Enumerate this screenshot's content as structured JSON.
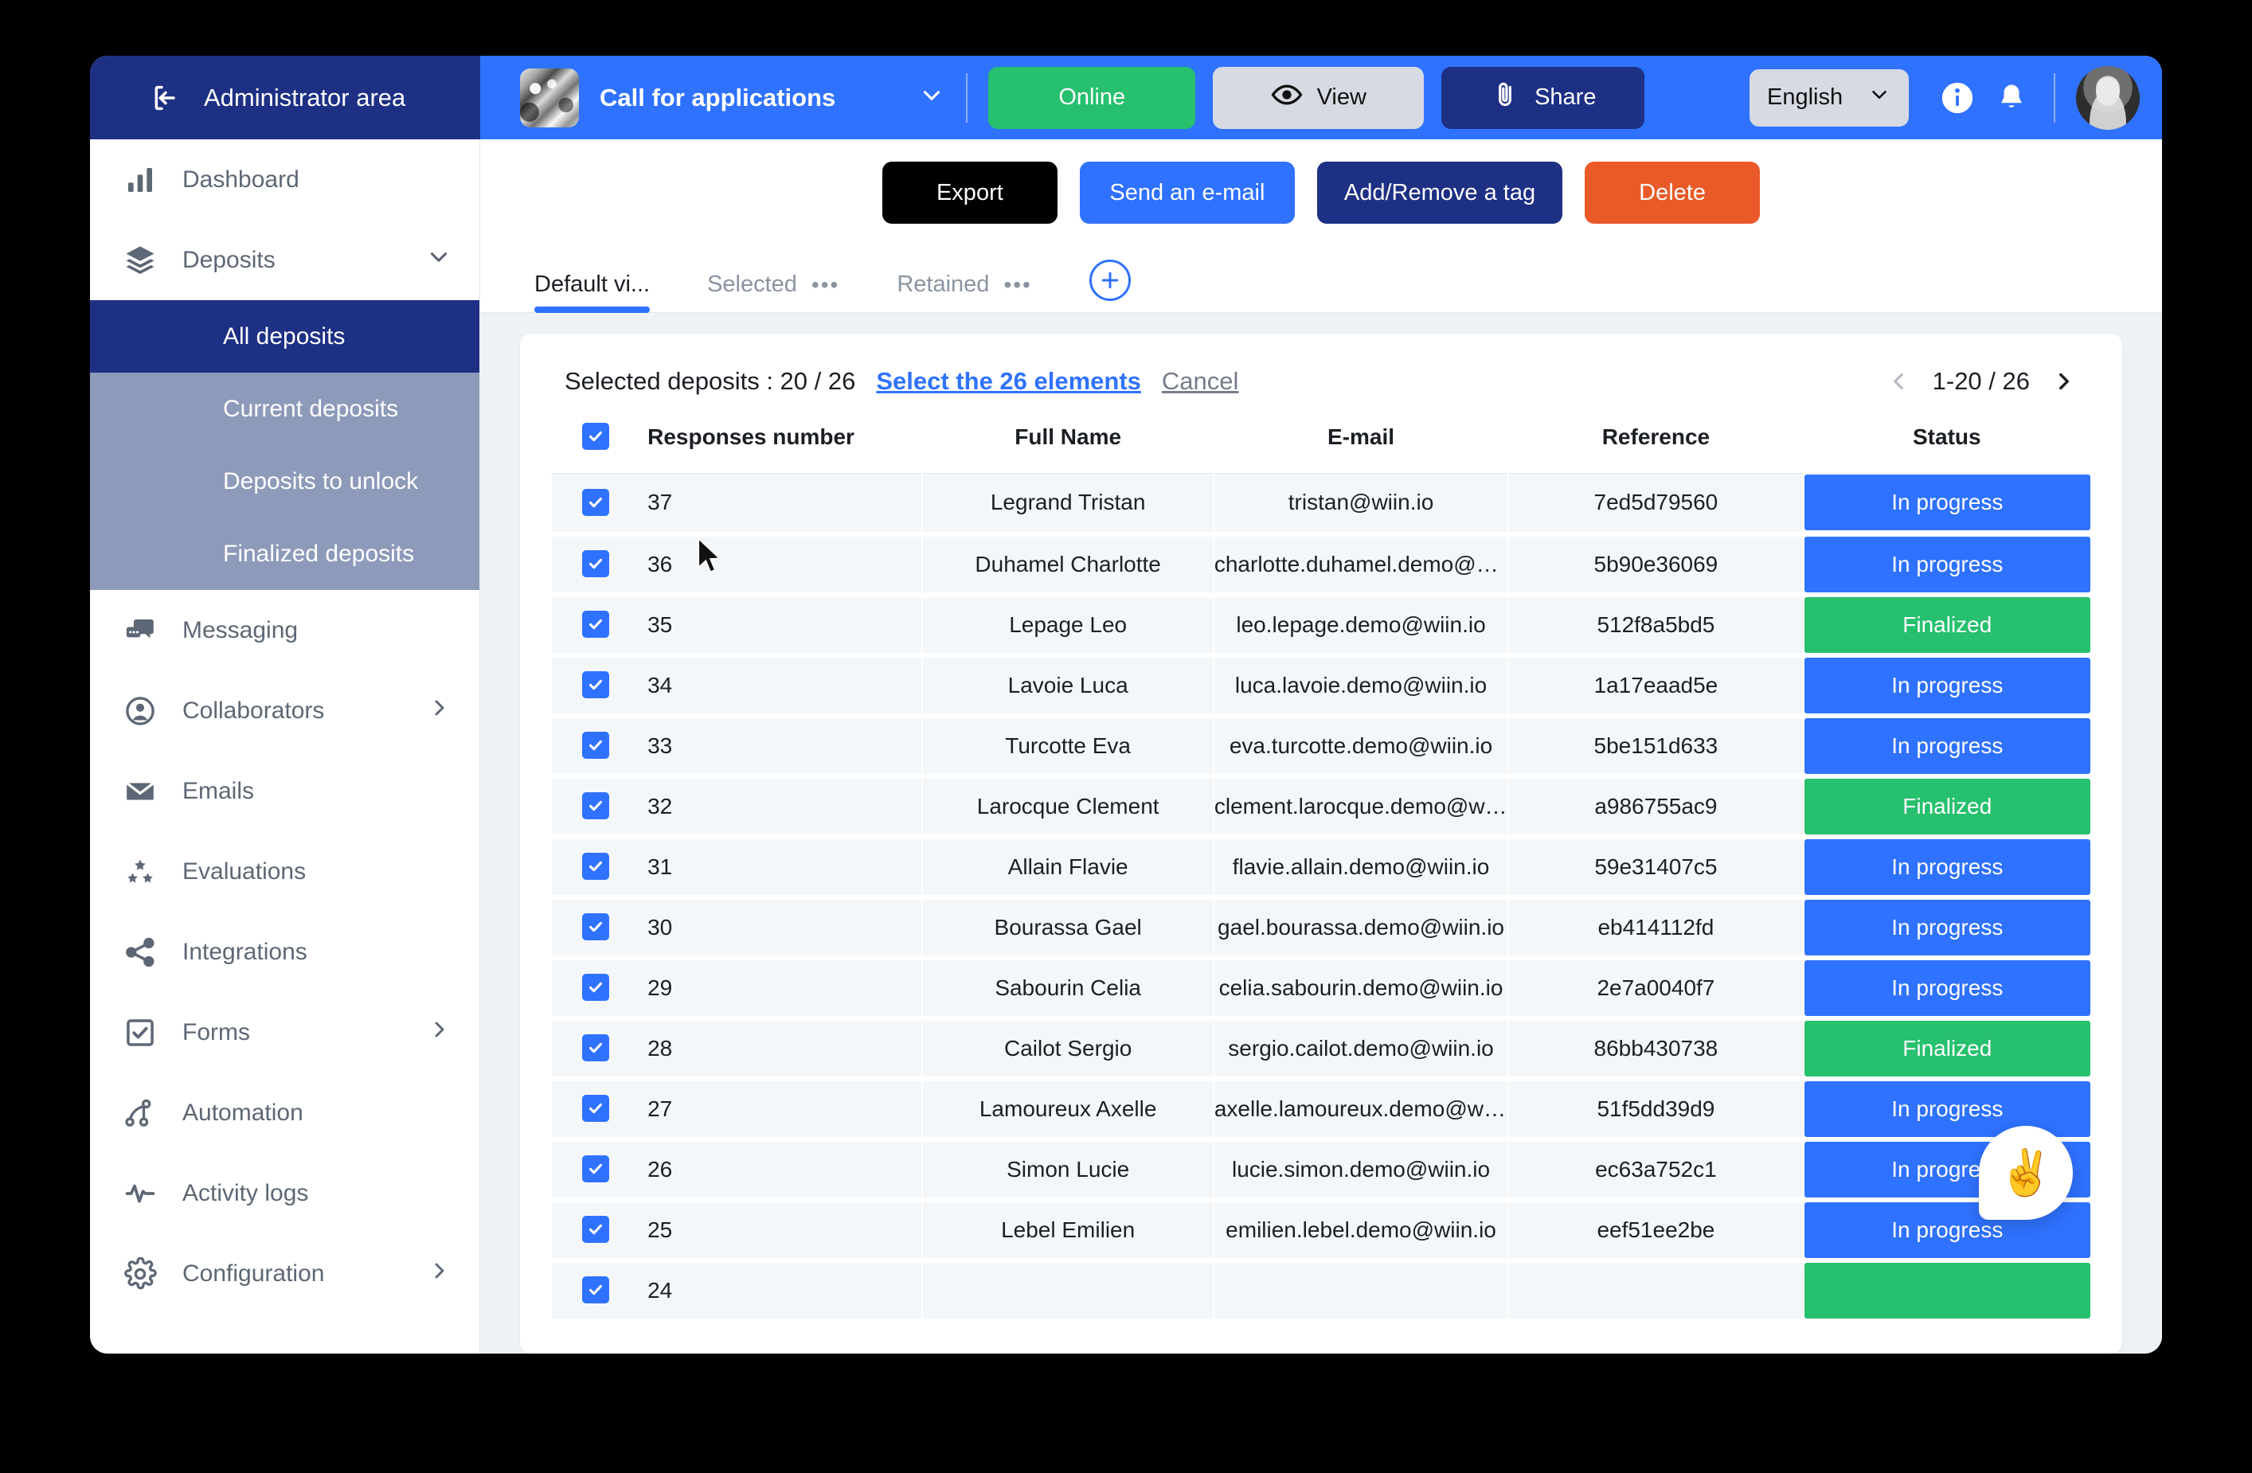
{
  "topbar": {
    "admin_area_label": "Administrator area",
    "project_title": "Call for applications",
    "online_label": "Online",
    "view_label": "View",
    "share_label": "Share",
    "language": "English",
    "colors": {
      "brand_blue": "#2f72ff",
      "navy": "#1d3084",
      "green": "#26c06e",
      "orange": "#ea5a28"
    }
  },
  "sidebar": {
    "items": [
      {
        "label": "Dashboard",
        "icon": "bar-chart-icon",
        "chevron": ""
      },
      {
        "label": "Deposits",
        "icon": "layers-icon",
        "chevron": "down"
      },
      {
        "label": "Messaging",
        "icon": "chat-icon",
        "chevron": ""
      },
      {
        "label": "Collaborators",
        "icon": "user-circle-icon",
        "chevron": "right"
      },
      {
        "label": "Emails",
        "icon": "envelope-icon",
        "chevron": ""
      },
      {
        "label": "Evaluations",
        "icon": "stars-icon",
        "chevron": ""
      },
      {
        "label": "Integrations",
        "icon": "share-nodes-icon",
        "chevron": ""
      },
      {
        "label": "Forms",
        "icon": "checkbox-icon",
        "chevron": "right"
      },
      {
        "label": "Automation",
        "icon": "automation-icon",
        "chevron": ""
      },
      {
        "label": "Activity logs",
        "icon": "pulse-icon",
        "chevron": ""
      },
      {
        "label": "Configuration",
        "icon": "gear-icon",
        "chevron": "right"
      }
    ],
    "sub_items": [
      {
        "label": "All deposits",
        "active": true
      },
      {
        "label": "Current deposits",
        "active": false
      },
      {
        "label": "Deposits to unlock",
        "active": false
      },
      {
        "label": "Finalized deposits",
        "active": false
      }
    ]
  },
  "actions": {
    "export": "Export",
    "send_email": "Send an e-mail",
    "add_remove_tag": "Add/Remove a tag",
    "delete": "Delete"
  },
  "tabs": [
    {
      "label": "Default vi...",
      "active": true,
      "has_dots": false
    },
    {
      "label": "Selected",
      "active": false,
      "has_dots": true
    },
    {
      "label": "Retained",
      "active": false,
      "has_dots": true
    }
  ],
  "tab_add_label": "+",
  "selection": {
    "summary": "Selected deposits : 20 / 26",
    "select_all_link": "Select the 26 elements",
    "cancel_label": "Cancel"
  },
  "pagination": {
    "range": "1-20 / 26",
    "prev_icon": "chevron-left-icon",
    "next_icon": "chevron-right-icon"
  },
  "table": {
    "headers": [
      "Responses number",
      "Full Name",
      "E-mail",
      "Reference",
      "Status"
    ],
    "rows": [
      {
        "checked": true,
        "number": "37",
        "name": "Legrand Tristan",
        "email": "tristan@wiin.io",
        "reference": "7ed5d79560",
        "status": "In progress",
        "status_kind": "progress"
      },
      {
        "checked": true,
        "number": "36",
        "name": "Duhamel Charlotte",
        "email": "charlotte.duhamel.demo@w...",
        "reference": "5b90e36069",
        "status": "In progress",
        "status_kind": "progress"
      },
      {
        "checked": true,
        "number": "35",
        "name": "Lepage Leo",
        "email": "leo.lepage.demo@wiin.io",
        "reference": "512f8a5bd5",
        "status": "Finalized",
        "status_kind": "final"
      },
      {
        "checked": true,
        "number": "34",
        "name": "Lavoie Luca",
        "email": "luca.lavoie.demo@wiin.io",
        "reference": "1a17eaad5e",
        "status": "In progress",
        "status_kind": "progress"
      },
      {
        "checked": true,
        "number": "33",
        "name": "Turcotte Eva",
        "email": "eva.turcotte.demo@wiin.io",
        "reference": "5be151d633",
        "status": "In progress",
        "status_kind": "progress"
      },
      {
        "checked": true,
        "number": "32",
        "name": "Larocque Clement",
        "email": "clement.larocque.demo@wii...",
        "reference": "a986755ac9",
        "status": "Finalized",
        "status_kind": "final"
      },
      {
        "checked": true,
        "number": "31",
        "name": "Allain Flavie",
        "email": "flavie.allain.demo@wiin.io",
        "reference": "59e31407c5",
        "status": "In progress",
        "status_kind": "progress"
      },
      {
        "checked": true,
        "number": "30",
        "name": "Bourassa Gael",
        "email": "gael.bourassa.demo@wiin.io",
        "reference": "eb414112fd",
        "status": "In progress",
        "status_kind": "progress"
      },
      {
        "checked": true,
        "number": "29",
        "name": "Sabourin Celia",
        "email": "celia.sabourin.demo@wiin.io",
        "reference": "2e7a0040f7",
        "status": "In progress",
        "status_kind": "progress"
      },
      {
        "checked": true,
        "number": "28",
        "name": "Cailot Sergio",
        "email": "sergio.cailot.demo@wiin.io",
        "reference": "86bb430738",
        "status": "Finalized",
        "status_kind": "final"
      },
      {
        "checked": true,
        "number": "27",
        "name": "Lamoureux Axelle",
        "email": "axelle.lamoureux.demo@wii...",
        "reference": "51f5dd39d9",
        "status": "In progress",
        "status_kind": "progress"
      },
      {
        "checked": true,
        "number": "26",
        "name": "Simon Lucie",
        "email": "lucie.simon.demo@wiin.io",
        "reference": "ec63a752c1",
        "status": "In progress",
        "status_kind": "progress"
      },
      {
        "checked": true,
        "number": "25",
        "name": "Lebel Emilien",
        "email": "emilien.lebel.demo@wiin.io",
        "reference": "eef51ee2be",
        "status": "In progress",
        "status_kind": "progress"
      },
      {
        "checked": true,
        "number": "24",
        "name": "",
        "email": "",
        "reference": "",
        "status": "",
        "status_kind": "final"
      }
    ],
    "header_checkbox_checked": true
  },
  "fab": {
    "emoji": "✌️"
  }
}
